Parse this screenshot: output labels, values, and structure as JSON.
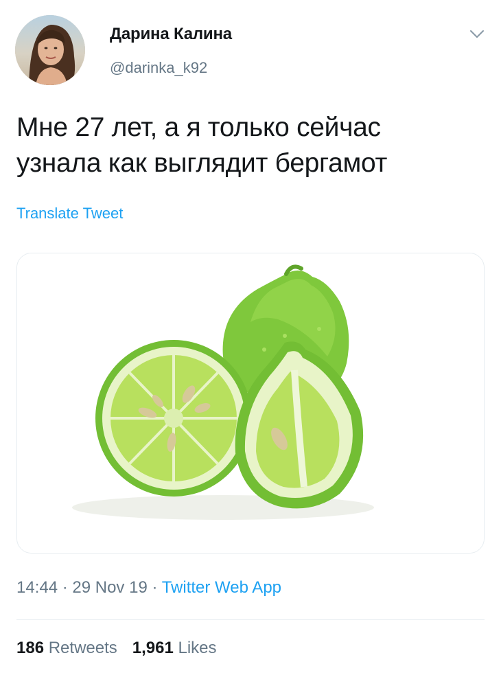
{
  "author": {
    "name": "Дарина Калина",
    "handle": "@darinka_k92"
  },
  "tweet": {
    "text_line1": "Мне 27 лет, а я только сейчас",
    "text_line2": "узнала как выглядит бергамот",
    "translate_label": "Translate Tweet"
  },
  "meta": {
    "time": "14:44",
    "sep1": " · ",
    "date": "29 Nov 19",
    "sep2": " · ",
    "source": "Twitter Web App"
  },
  "stats": {
    "retweets_count": "186",
    "retweets_label": "Retweets",
    "likes_count": "1,961",
    "likes_label": "Likes"
  },
  "icons": {
    "menu": "chevron-down-icon"
  },
  "colors": {
    "link": "#1da1f2",
    "secondary_text": "#657786",
    "primary_text": "#14171a",
    "border": "#e6ecf0"
  }
}
